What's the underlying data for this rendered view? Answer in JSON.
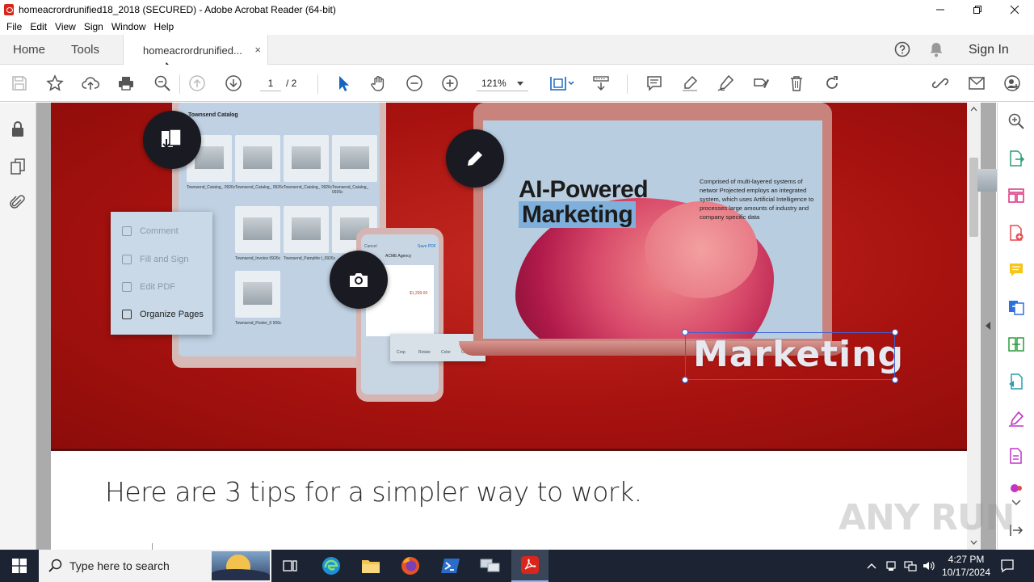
{
  "window": {
    "title": "homeacrordrunified18_2018 (SECURED) - Adobe Acrobat Reader (64-bit)"
  },
  "menu": [
    "File",
    "Edit",
    "View",
    "Sign",
    "Window",
    "Help"
  ],
  "tabs": {
    "home": "Home",
    "tools": "Tools",
    "document": "homeacrordrunified...",
    "close": "×"
  },
  "header": {
    "sign_in": "Sign In"
  },
  "toolbar": {
    "page_current": "1",
    "page_total": "/ 2",
    "zoom": "121%"
  },
  "document": {
    "banner": {
      "catalog_title": "Townsend Catalog",
      "context_menu": [
        "Comment",
        "Fill and Sign",
        "Edit PDF",
        "Organize Pages"
      ],
      "headline_line1": "AI-Powered",
      "headline_line2": "Marketing",
      "paragraph": "Comprised of multi-layered systems of networ Projected employs an integrated system, which uses Artificial Intelligence to processes large amounts of industry and company specific data",
      "selected_word": "Marketing",
      "thumb_labels": [
        "Townsend_Catalog_ 0926c",
        "Townsend_Catalog_ 0926c",
        "Townsend_Catalog_ 0926c",
        "Townsend_Catalog_ 0926c",
        "Townsend_Invoice 0926c",
        "Townsend_Pamphle t_0926c",
        "Townsend_Poster_0 926c"
      ],
      "phone_header_left": "Cancel",
      "phone_header_right": "Save PDF",
      "phone_doc_title": "ACME Agency",
      "phone_price": "$1,299.00",
      "phone_tools": [
        "Crop",
        "Rotate",
        "Color",
        "Cleanup"
      ]
    },
    "tips_heading": "Here are 3 tips for a simpler way to work."
  },
  "watermark": "ANY RUN",
  "taskbar": {
    "search_placeholder": "Type here to search",
    "time": "4:27 PM",
    "date": "10/17/2024"
  }
}
